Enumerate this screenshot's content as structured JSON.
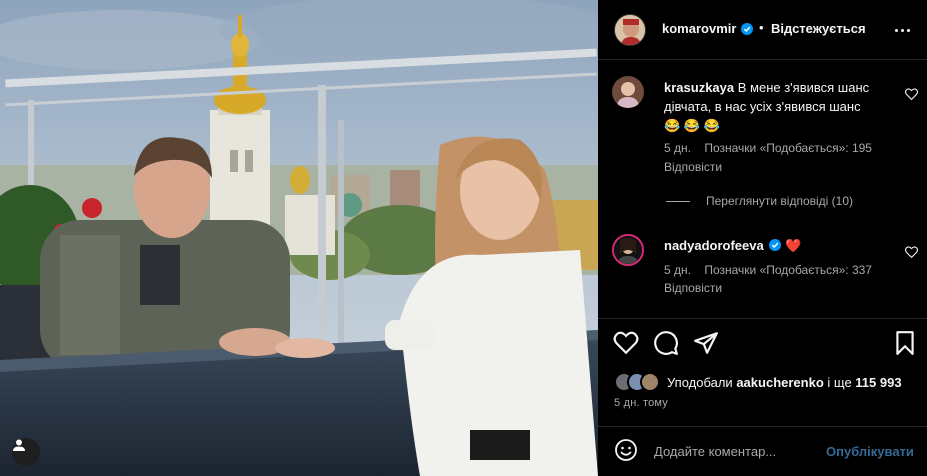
{
  "colors": {
    "background": "#000000",
    "text": "#f5f5f5",
    "secondary_text": "#a8a8a8",
    "divider": "#262626",
    "verified_blue": "#0095f6",
    "post_button": "#356a96",
    "heart_red": "#ed4956"
  },
  "photo": {
    "user_tag_icon": "user-icon"
  },
  "header": {
    "username": "komarovmir",
    "separator": "•",
    "follow_status": "Відстежується",
    "more_icon": "more-horizontal-icon"
  },
  "comments": [
    {
      "username": "krasuzkaya",
      "text": "В мене з'явився шанс дівчата, в нас усіх з'явився шанс",
      "emojis": "😂 😂 😂",
      "age": "5 дн.",
      "likes": "Позначки «Подобається»: 195",
      "reply": "Відповісти",
      "view_replies": "Переглянути відповіді (10)"
    },
    {
      "username": "nadyadorofeeva",
      "text": "❤️",
      "age": "5 дн.",
      "likes": "Позначки «Подобається»: 337",
      "reply": "Відповісти"
    }
  ],
  "actions": {
    "like_icon": "heart-icon",
    "comment_icon": "comment-icon",
    "share_icon": "send-icon",
    "save_icon": "bookmark-icon"
  },
  "likes": {
    "prefix": "Уподобали",
    "user": "aakucherenko",
    "middle": "і ще",
    "count": "115 993"
  },
  "time": "5 дн. тому",
  "add_comment": {
    "placeholder": "Додайте коментар...",
    "post_label": "Опублікувати"
  }
}
